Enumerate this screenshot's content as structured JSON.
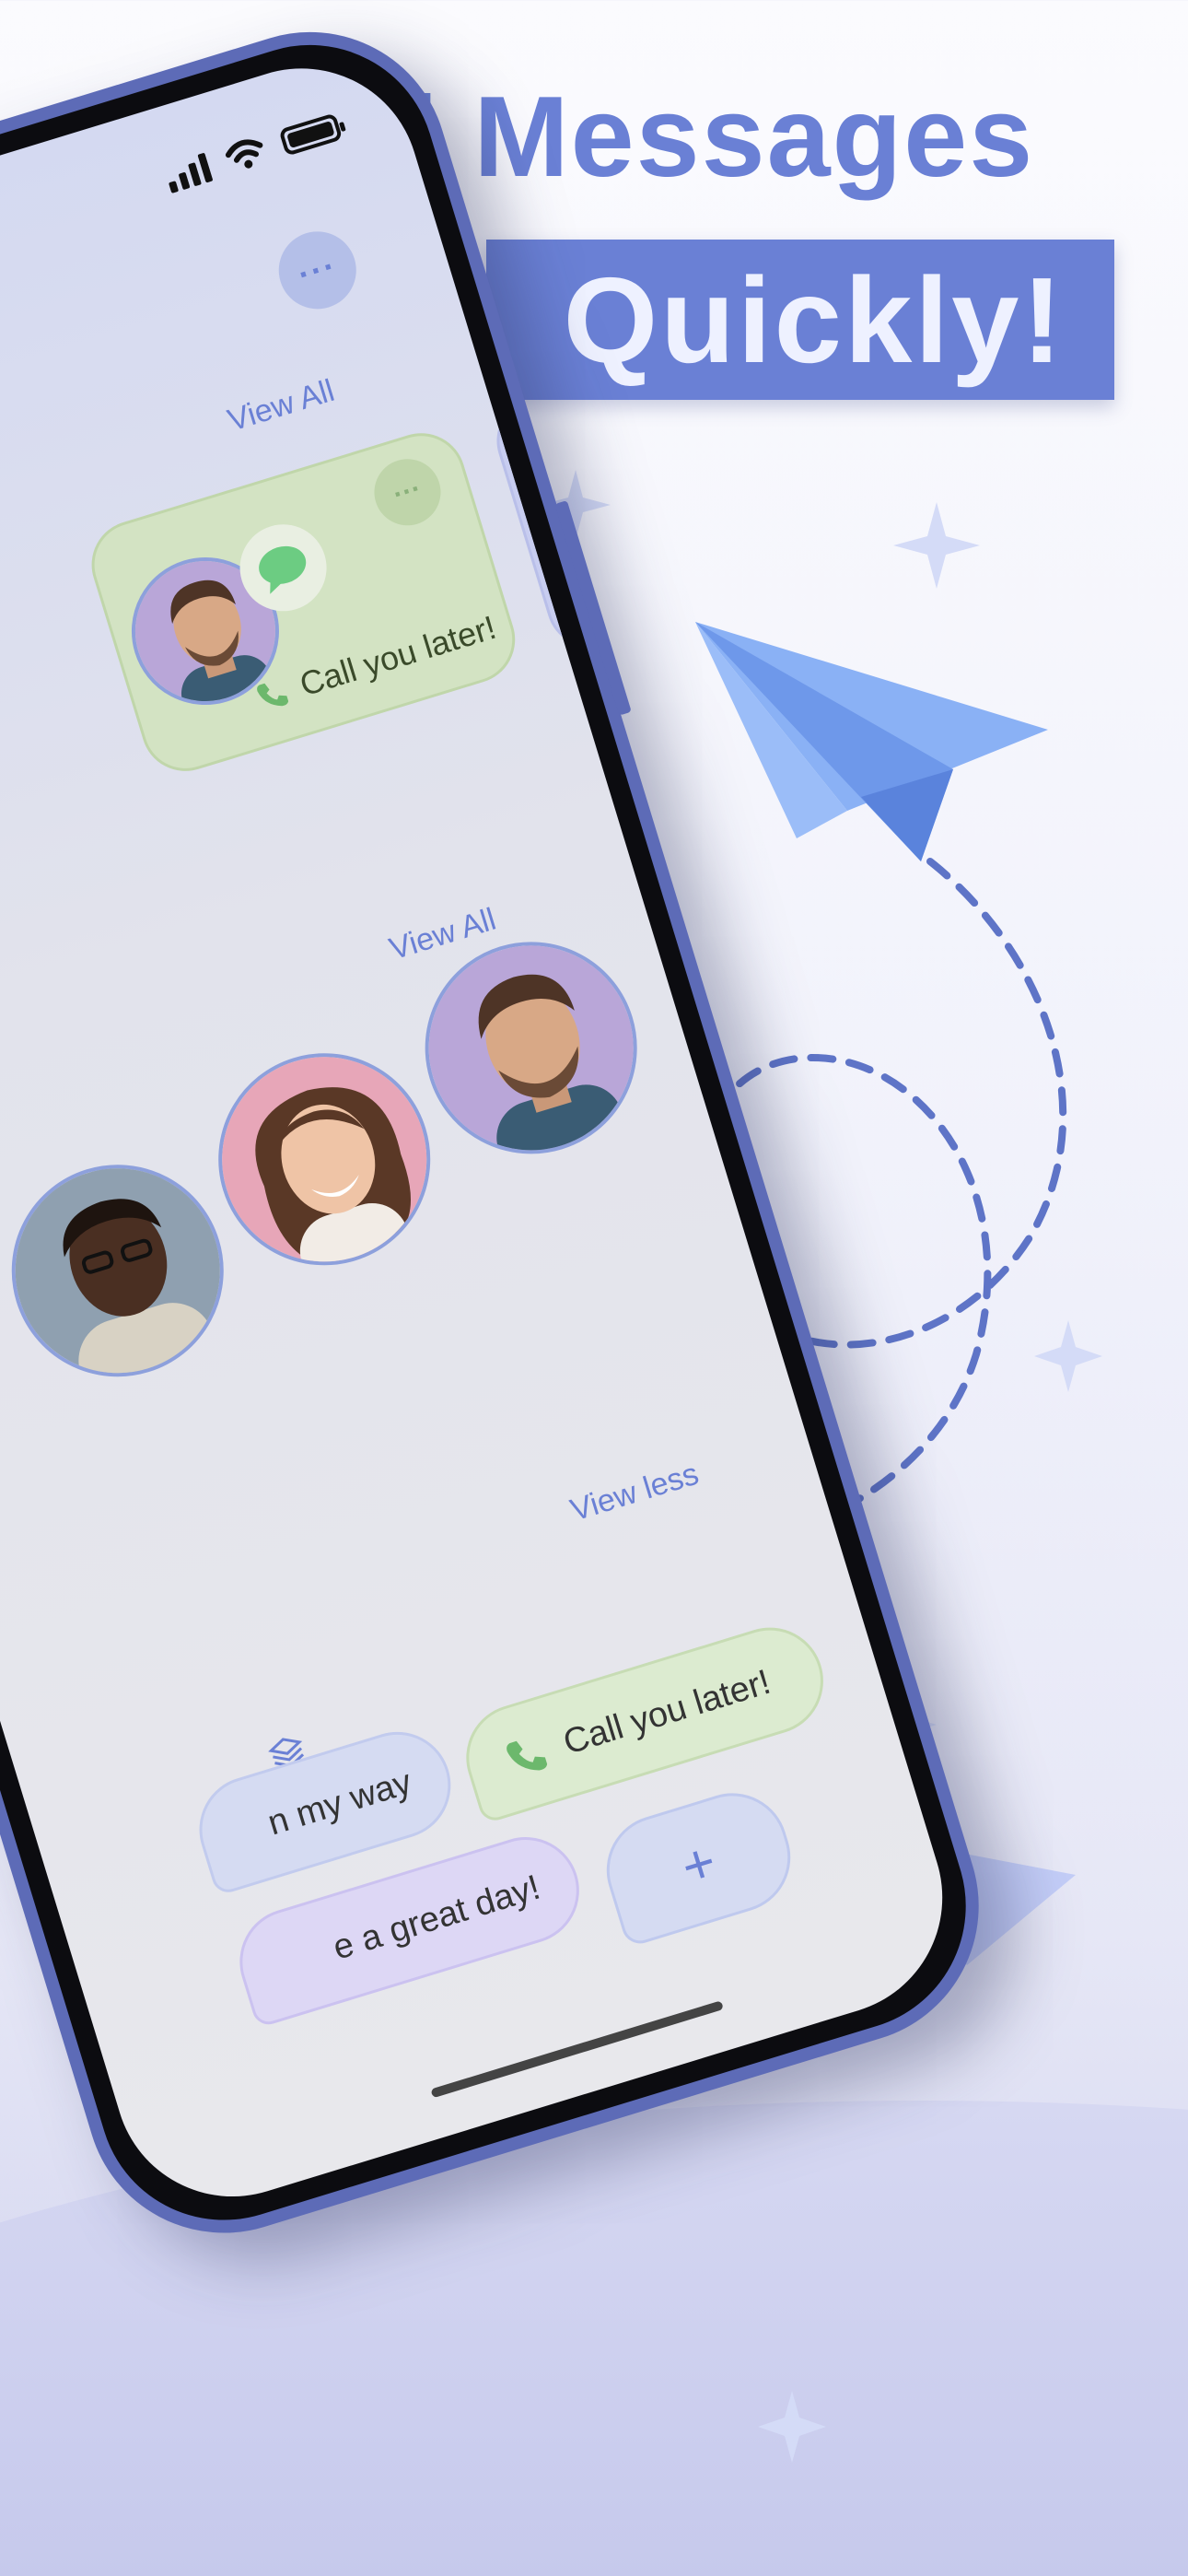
{
  "promo": {
    "headline": "Send Messages",
    "highlight": "Quickly!",
    "accent_color": "#6a80d5"
  },
  "app": {
    "more_label": "···",
    "sections": {
      "recent_view_all": "View All",
      "contacts_view_all": "View All",
      "quick_replies_toggle": "View less"
    },
    "recent_card": {
      "message": "Call you later!",
      "more_label": "···"
    },
    "quick_replies": [
      {
        "text": "Call you later!",
        "icon": "phone-icon"
      },
      {
        "text": "n my way"
      },
      {
        "text": "e a great day!"
      }
    ],
    "add_reply_label": "+"
  }
}
